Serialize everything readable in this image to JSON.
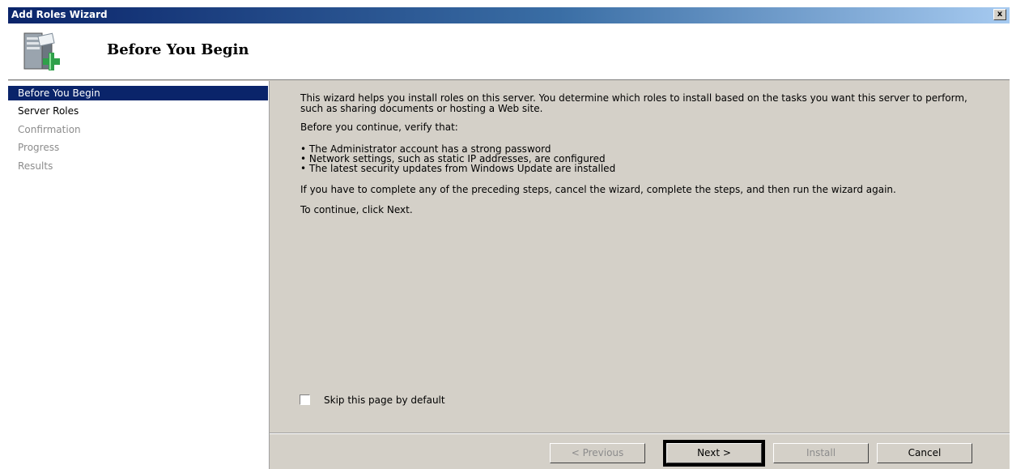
{
  "window": {
    "title": "Add Roles Wizard",
    "close_label": "x"
  },
  "header": {
    "title": "Before You Begin",
    "icon": "server-add-icon"
  },
  "sidebar": {
    "items": [
      {
        "label": "Before You Begin",
        "state": "active"
      },
      {
        "label": "Server Roles",
        "state": "enabled"
      },
      {
        "label": "Confirmation",
        "state": "disabled"
      },
      {
        "label": "Progress",
        "state": "disabled"
      },
      {
        "label": "Results",
        "state": "disabled"
      }
    ]
  },
  "content": {
    "intro": "This wizard helps you install roles on this server. You determine which roles to install based on the tasks you want this server to perform, such as sharing documents or hosting a Web site.",
    "verify_heading": "Before you continue, verify that:",
    "checklist": [
      "• The Administrator account has a strong password",
      "• Network settings, such as static IP addresses, are configured",
      "• The latest security updates from Windows Update are installed"
    ],
    "cancel_note": "If you have to complete any of the preceding steps, cancel the wizard, complete the steps, and then run the wizard again.",
    "continue_note": "To continue, click Next."
  },
  "skip_checkbox": {
    "label": "Skip this page by default",
    "checked": false
  },
  "buttons": {
    "previous": "< Previous",
    "next": "Next >",
    "install": "Install",
    "cancel": "Cancel"
  },
  "colors": {
    "selection": "#0a246a",
    "face": "#d4d0c8"
  }
}
